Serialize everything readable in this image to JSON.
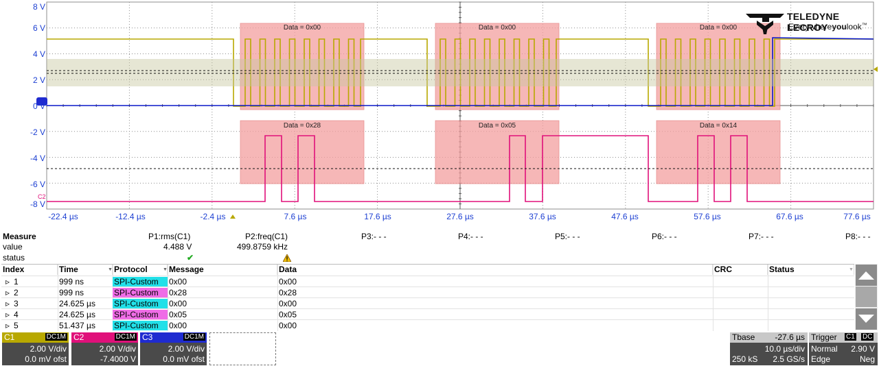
{
  "scope": {
    "y_labels": [
      "8 V",
      "6 V",
      "4 V",
      "2 V",
      "0 V",
      "-2 V",
      "-4 V",
      "-6 V",
      "-8 V"
    ],
    "x_labels": [
      "-22.4 µs",
      "-12.4 µs",
      "-2.4 µs",
      "7.6 µs",
      "17.6 µs",
      "27.6 µs",
      "37.6 µs",
      "47.6 µs",
      "57.6 µs",
      "67.6 µs",
      "77.6 µs"
    ],
    "c2_marker": "C2",
    "annotations_top": [
      "Data = 0x00",
      "Data = 0x00",
      "Data = 0x00"
    ],
    "annotations_bottom": [
      "Data = 0x28",
      "Data = 0x05",
      "Data = 0x14"
    ],
    "colors": {
      "c1": "#a8a000",
      "c2": "#e0007a",
      "c3": "#0a18c8",
      "grid": "#8c8c8c",
      "highlight": "#f4a0a0"
    }
  },
  "logo": {
    "brand": "TELEDYNE LECROY",
    "tagline_a": "Everywhere",
    "tagline_b": "you",
    "tagline_c": "look",
    "tm": "™"
  },
  "measure": {
    "title": "Measure",
    "row_value": "value",
    "row_status": "status",
    "params": [
      {
        "name": "P1:rms(C1)",
        "value": "4.488 V",
        "status": "ok"
      },
      {
        "name": "P2:freq(C1)",
        "value": "499.8759 kHz",
        "status": "warn"
      },
      {
        "name": "P3:- - -",
        "value": "",
        "status": ""
      },
      {
        "name": "P4:- - -",
        "value": "",
        "status": ""
      },
      {
        "name": "P5:- - -",
        "value": "",
        "status": ""
      },
      {
        "name": "P6:- - -",
        "value": "",
        "status": ""
      },
      {
        "name": "P7:- - -",
        "value": "",
        "status": ""
      },
      {
        "name": "P8:- - -",
        "value": "",
        "status": ""
      }
    ]
  },
  "table": {
    "headers": [
      "Index",
      "Time",
      "Protocol",
      "Message",
      "Data",
      "CRC",
      "Status"
    ],
    "rows": [
      {
        "index": "1",
        "time": "999 ns",
        "protocol": "SPI-Custom",
        "message": "0x00",
        "data": "0x00"
      },
      {
        "index": "2",
        "time": "999 ns",
        "protocol": "SPI-Custom",
        "message": "0x28",
        "data": "0x28"
      },
      {
        "index": "3",
        "time": "24.625 µs",
        "protocol": "SPI-Custom",
        "message": "0x00",
        "data": "0x00"
      },
      {
        "index": "4",
        "time": "24.625 µs",
        "protocol": "SPI-Custom",
        "message": "0x05",
        "data": "0x05"
      },
      {
        "index": "5",
        "time": "51.437 µs",
        "protocol": "SPI-Custom",
        "message": "0x00",
        "data": "0x00"
      }
    ]
  },
  "channels": [
    {
      "name": "C1",
      "coupling": "DC1M",
      "vdiv": "2.00 V/div",
      "offset": "0.0 mV ofst",
      "color": "#b8a800"
    },
    {
      "name": "C2",
      "coupling": "DC1M",
      "vdiv": "2.00 V/div",
      "offset": "-7.4000 V",
      "color": "#e0107a"
    },
    {
      "name": "C3",
      "coupling": "DC1M",
      "vdiv": "2.00 V/div",
      "offset": "0.0 mV ofst",
      "color": "#1f2bd0"
    }
  ],
  "timebase": {
    "label": "Tbase",
    "delay": "-27.6 µs",
    "tdiv": "10.0 µs/div",
    "sample": "250 kS",
    "rate": "2.5 GS/s"
  },
  "trigger": {
    "label": "Trigger",
    "src": "C1",
    "cpl": "DC",
    "mode": "Normal",
    "level": "2.90 V",
    "type": "Edge",
    "slope": "Neg"
  }
}
